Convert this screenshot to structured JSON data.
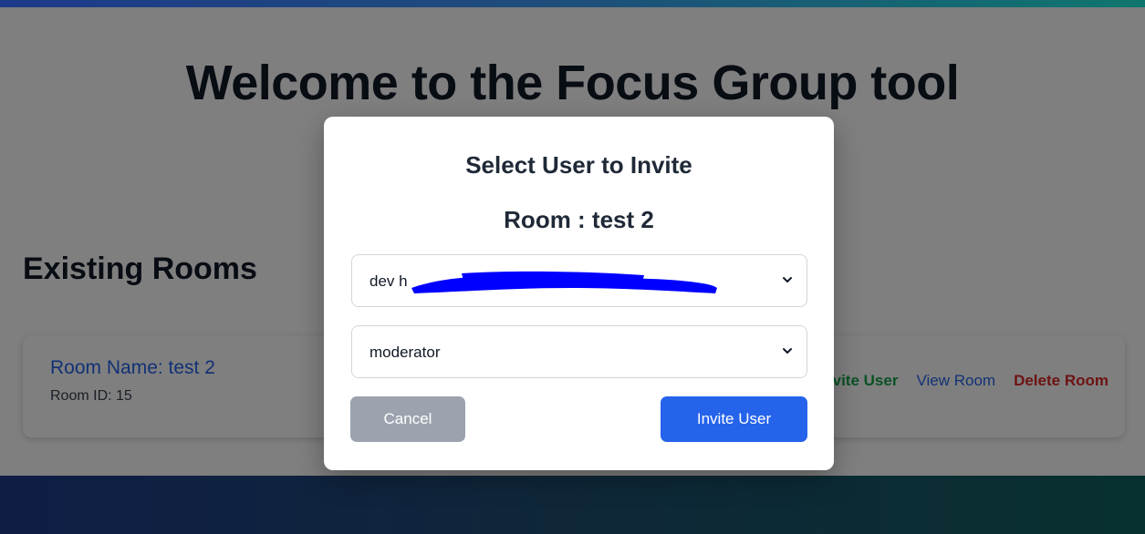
{
  "page": {
    "title": "Welcome to the Focus Group tool",
    "section_title": "Existing Rooms"
  },
  "room": {
    "name": "Room Name: test 2",
    "id": "Room ID: 15",
    "actions": {
      "invite": "Invite User",
      "view": "View Room",
      "delete": "Delete Room"
    }
  },
  "modal": {
    "title": "Select User to Invite",
    "room_label": "Room : test 2",
    "user_select_prefix": "dev h",
    "role_select_value": "moderator",
    "cancel_label": "Cancel",
    "invite_label": "Invite User"
  },
  "colors": {
    "accent": "#2563eb",
    "invite_action": "#16a34a",
    "delete_action": "#dc2626",
    "redaction": "#0000ff"
  },
  "icons": {
    "select_chevron": "chevron-down-icon"
  }
}
